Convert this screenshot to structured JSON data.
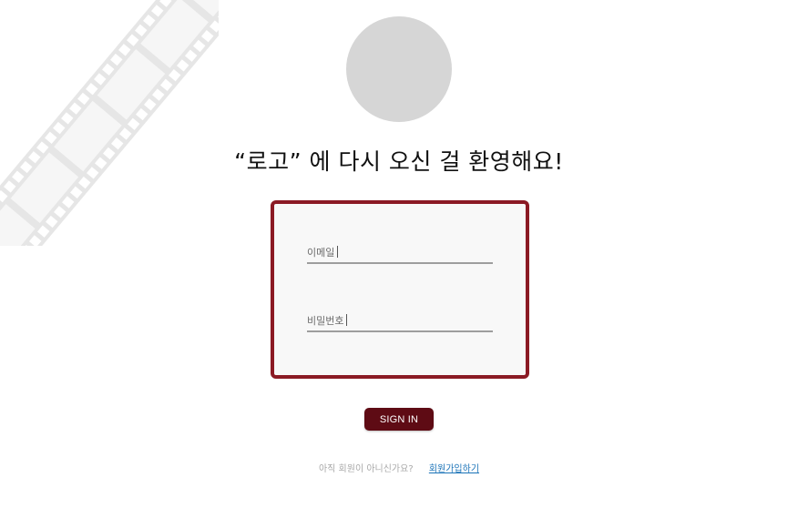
{
  "logo": {
    "placeholder_color": "#d6d6d6"
  },
  "title": "“로고” 에 다시 오신 걸 환영해요!",
  "form": {
    "email_label": "이메일",
    "password_label": "비밀번호",
    "border_color": "#8b1a24"
  },
  "signin_button": {
    "label": "SIGN IN",
    "color": "#5e0b14"
  },
  "signup": {
    "question": "아직 회원이 아니신가요?",
    "link_label": "회원가입하기",
    "link_color": "#1a73b8"
  },
  "decoration": {
    "filmstrip_icon": "film-strip-icon"
  }
}
